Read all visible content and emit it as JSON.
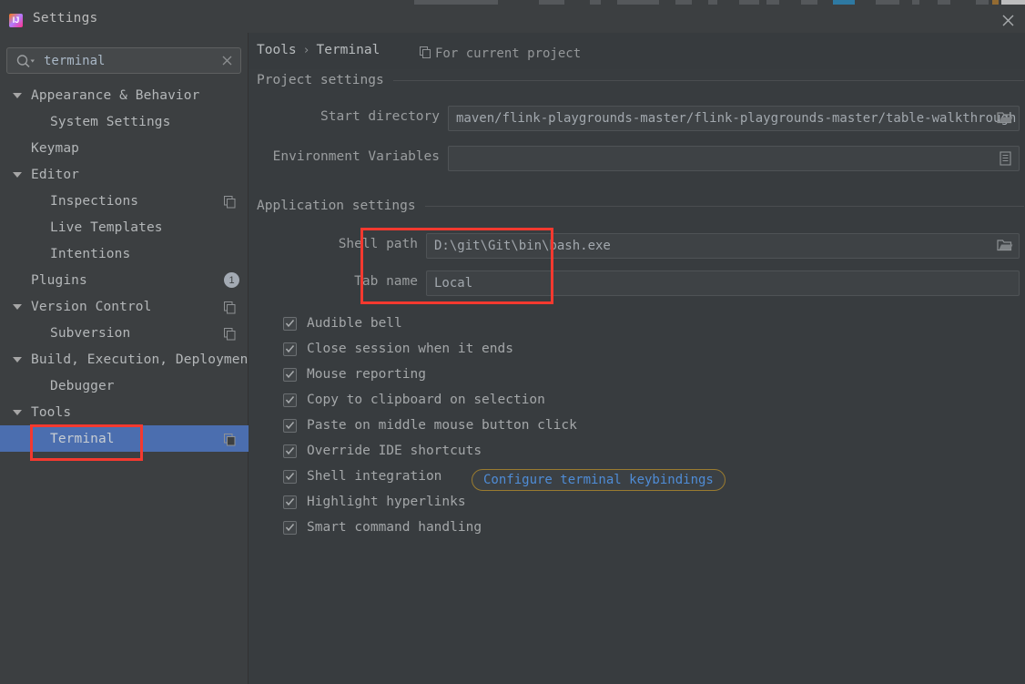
{
  "window": {
    "title": "Settings",
    "app_icon": "intellij-idea-icon",
    "close_icon": "close-icon"
  },
  "sidebar": {
    "search": {
      "value": "terminal",
      "placeholder": "",
      "search_icon": "search-icon",
      "clear_icon": "clear-icon"
    },
    "items": [
      {
        "label": "Appearance & Behavior",
        "level": 0,
        "expanded": true,
        "arrow": true,
        "selected": false,
        "copy_icon": false,
        "badge": null
      },
      {
        "label": "System Settings",
        "level": 2,
        "expanded": false,
        "arrow": false,
        "selected": false,
        "copy_icon": false,
        "badge": null
      },
      {
        "label": "Keymap",
        "level": 1,
        "expanded": false,
        "arrow": false,
        "selected": false,
        "copy_icon": false,
        "badge": null
      },
      {
        "label": "Editor",
        "level": 0,
        "expanded": true,
        "arrow": true,
        "selected": false,
        "copy_icon": false,
        "badge": null
      },
      {
        "label": "Inspections",
        "level": 2,
        "expanded": false,
        "arrow": false,
        "selected": false,
        "copy_icon": true,
        "badge": null
      },
      {
        "label": "Live Templates",
        "level": 2,
        "expanded": false,
        "arrow": false,
        "selected": false,
        "copy_icon": false,
        "badge": null
      },
      {
        "label": "Intentions",
        "level": 2,
        "expanded": false,
        "arrow": false,
        "selected": false,
        "copy_icon": false,
        "badge": null
      },
      {
        "label": "Plugins",
        "level": 1,
        "expanded": false,
        "arrow": false,
        "selected": false,
        "copy_icon": false,
        "badge": "1"
      },
      {
        "label": "Version Control",
        "level": 0,
        "expanded": true,
        "arrow": true,
        "selected": false,
        "copy_icon": true,
        "badge": null
      },
      {
        "label": "Subversion",
        "level": 2,
        "expanded": false,
        "arrow": false,
        "selected": false,
        "copy_icon": true,
        "badge": null
      },
      {
        "label": "Build, Execution, Deployment",
        "level": 0,
        "expanded": true,
        "arrow": true,
        "selected": false,
        "copy_icon": false,
        "badge": null
      },
      {
        "label": "Debugger",
        "level": 2,
        "expanded": false,
        "arrow": false,
        "selected": false,
        "copy_icon": false,
        "badge": null
      },
      {
        "label": "Tools",
        "level": 0,
        "expanded": true,
        "arrow": true,
        "selected": false,
        "copy_icon": false,
        "badge": null
      },
      {
        "label": "Terminal",
        "level": 2,
        "expanded": false,
        "arrow": false,
        "selected": true,
        "copy_icon": true,
        "badge": null
      }
    ]
  },
  "content": {
    "breadcrumb": {
      "parent": "Tools",
      "separator": "›",
      "current": "Terminal"
    },
    "scope": {
      "text": "For current project",
      "icon": "copy-icon"
    },
    "project_settings": {
      "title": "Project settings",
      "start_directory": {
        "label": "Start directory",
        "value": "maven/flink-playgrounds-master/flink-playgrounds-master/table-walkthrough",
        "button_icon": "folder-icon"
      },
      "environment_variables": {
        "label": "Environment Variables",
        "value": "",
        "button_icon": "list-edit-icon"
      }
    },
    "application_settings": {
      "title": "Application settings",
      "shell_path": {
        "label": "Shell path",
        "value": "D:\\git\\Git\\bin\\bash.exe",
        "button_icon": "folder-icon"
      },
      "tab_name": {
        "label": "Tab name",
        "value": "Local"
      },
      "checkboxes": [
        {
          "label": "Audible bell",
          "checked": true
        },
        {
          "label": "Close session when it ends",
          "checked": true
        },
        {
          "label": "Mouse reporting",
          "checked": true
        },
        {
          "label": "Copy to clipboard on selection",
          "checked": true
        },
        {
          "label": "Paste on middle mouse button click",
          "checked": true
        },
        {
          "label": "Override IDE shortcuts",
          "checked": true
        },
        {
          "label": "Shell integration",
          "checked": true
        },
        {
          "label": "Highlight hyperlinks",
          "checked": true
        },
        {
          "label": "Smart command handling",
          "checked": true
        }
      ],
      "keybindings_link": "Configure terminal keybindings"
    }
  },
  "annotations": {
    "color": "#f4392f",
    "boxes": [
      {
        "name": "terminal-sidebar-highlight"
      },
      {
        "name": "shell-path-tab-name-highlight"
      }
    ]
  },
  "colors": {
    "window_bg": "#3c3f41",
    "content_bg": "#383c3f",
    "selection_blue": "#4b6eaf",
    "link_blue": "#4f8cd6",
    "annotation_red": "#f4392f",
    "focus_gold": "#9a7b2f"
  }
}
